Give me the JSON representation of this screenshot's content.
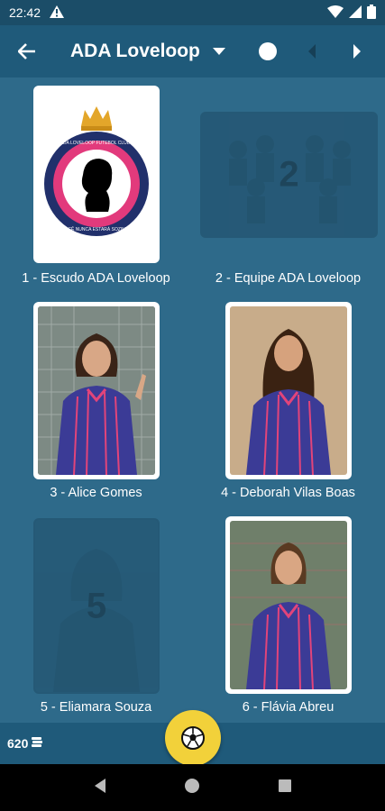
{
  "status": {
    "time": "22:42"
  },
  "app_bar": {
    "title": "ADA Loveloop"
  },
  "cards": [
    {
      "caption": "1 - Escudo ADA Loveloop",
      "filled": true,
      "number": "1"
    },
    {
      "caption": "2 - Equipe ADA Loveloop",
      "filled": false,
      "number": "2"
    },
    {
      "caption": "3 - Alice Gomes",
      "filled": true,
      "number": "3"
    },
    {
      "caption": "4 - Deborah Vilas Boas",
      "filled": true,
      "number": "4"
    },
    {
      "caption": "5 - Eliamara Souza",
      "filled": false,
      "number": "5"
    },
    {
      "caption": "6 - Flávia Abreu",
      "filled": true,
      "number": "6"
    }
  ],
  "bottom_bar": {
    "coins": "620"
  },
  "colors": {
    "background": "#2e6a8a",
    "app_bar": "#1f5a7a",
    "status_bar": "#1b4d68",
    "fab": "#f2d13a"
  },
  "logo": {
    "ring_text_top": "ADA LOVELOOP FUTEBOL CLUBE",
    "ring_text_bottom": "VOCÊ NUNCA ESTARÁ SOZINHA"
  }
}
